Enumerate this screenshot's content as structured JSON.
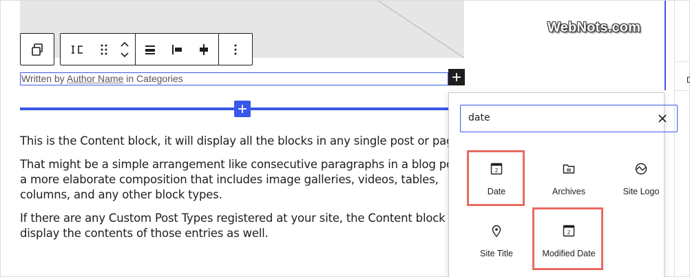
{
  "watermark": "WebNots.com",
  "post_meta": {
    "prefix": "Written by ",
    "author": "Author Name",
    "suffix": " in Categories"
  },
  "content": {
    "paragraphs": [
      "This is the Content block, it will display all the blocks in any single post or page.",
      "That might be a simple arrangement like consecutive paragraphs in a blog post,",
      "a more elaborate composition that includes image galleries, videos, tables,",
      "columns, and any other block types.",
      "If there are any Custom Post Types registered at your site, the Content block ca",
      "display the contents of those entries as well."
    ]
  },
  "right_panel": {
    "letter": "D"
  },
  "inserter": {
    "search_value": "date",
    "results": [
      {
        "label": "Date",
        "icon": "calendar-icon",
        "highlighted": true
      },
      {
        "label": "Archives",
        "icon": "folder-icon",
        "highlighted": false
      },
      {
        "label": "Site Logo",
        "icon": "site-logo-icon",
        "highlighted": false
      },
      {
        "label": "Site Title",
        "icon": "map-pin-icon",
        "highlighted": false
      },
      {
        "label": "Modified Date",
        "icon": "calendar-icon",
        "highlighted": true
      }
    ],
    "calendar_day": "2"
  },
  "colors": {
    "accent": "#3858e9",
    "highlight": "#e96a61",
    "dark": "#1e1e1e"
  }
}
